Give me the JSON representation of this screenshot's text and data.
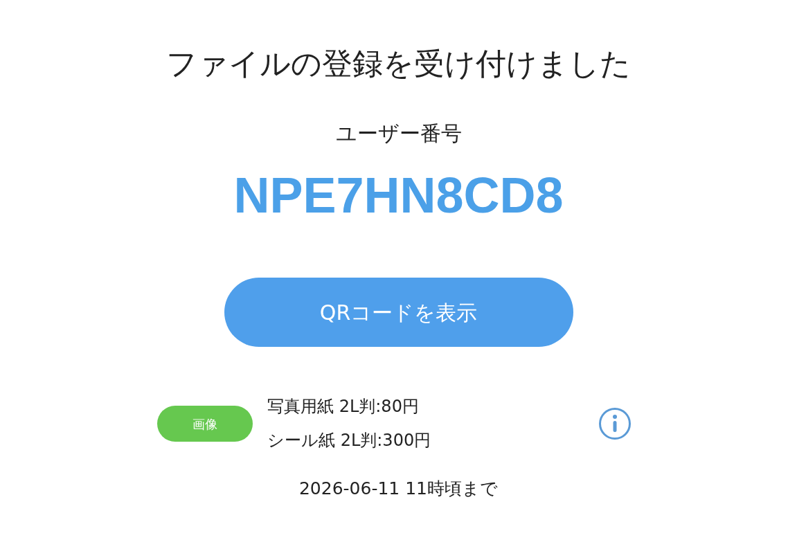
{
  "title": "ファイルの登録を受け付けました",
  "user_number": {
    "label": "ユーザー番号",
    "value": "NPE7HN8CD8"
  },
  "qr_button": {
    "label": "QRコードを表示"
  },
  "file": {
    "badge": "画像",
    "prices": [
      "写真用紙 2L判:80円",
      "シール紙 2L判:300円"
    ]
  },
  "deadline": "2026-06-11 11時頃まで"
}
